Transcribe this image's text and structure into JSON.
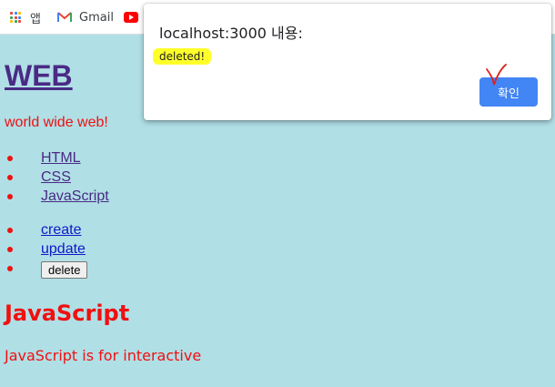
{
  "bookmarks": {
    "apps_label": "앱",
    "gmail_label": "Gmail",
    "youtube_icon": "youtube-icon"
  },
  "page": {
    "title": "WEB",
    "subtitle": "world wide web!",
    "topics": [
      "HTML",
      "CSS",
      "JavaScript"
    ],
    "controls": {
      "create": "create",
      "update": "update",
      "delete": "delete"
    },
    "section_title": "JavaScript",
    "section_desc": "JavaScript is for interactive"
  },
  "dialog": {
    "title": "localhost:3000 내용:",
    "message": "deleted!",
    "ok_label": "확인"
  },
  "colors": {
    "page_background": "#b0dfe6",
    "accent_red": "#f01010",
    "link_purple": "#4a2a84",
    "link_blue": "#1018c8",
    "dialog_button": "#4285f4",
    "highlight": "#ffff2a",
    "annotation": "#e0201a"
  }
}
